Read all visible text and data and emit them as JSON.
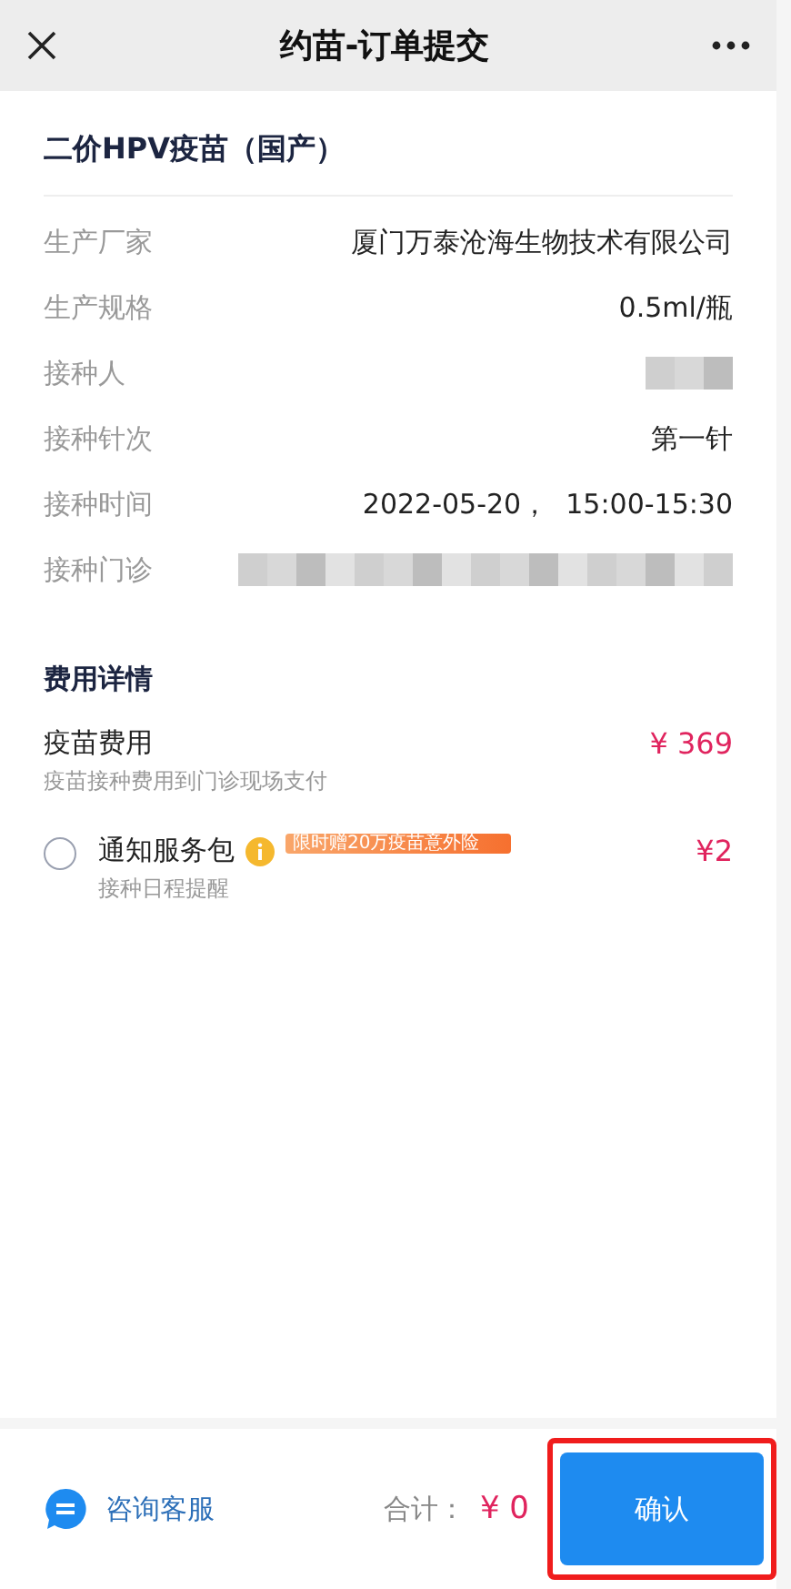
{
  "header": {
    "title": "约苗-订单提交"
  },
  "vaccine": {
    "name": "二价HPV疫苗（国产）"
  },
  "details": [
    {
      "label": "生产厂家",
      "kind": "text",
      "value": "厦门万泰沧海生物技术有限公司"
    },
    {
      "label": "生产规格",
      "kind": "text",
      "value": "0.5ml/瓶"
    },
    {
      "label": "接种人",
      "kind": "blurred"
    },
    {
      "label": "接种针次",
      "kind": "text",
      "value": "第一针"
    },
    {
      "label": "接种时间",
      "kind": "text",
      "value": "2022-05-20，  15:00-15:30"
    },
    {
      "label": "接种门诊",
      "kind": "blurred-wide"
    }
  ],
  "fees": {
    "title": "费用详情",
    "vaccine_fee": {
      "label": "疫苗费用",
      "note": "疫苗接种费用到门诊现场支付",
      "amount": "¥ 369"
    },
    "service": {
      "label": "通知服务包",
      "badge": "限时赠20万疫苗意外险",
      "note": "接种日程提醒",
      "amount": "¥2",
      "selected": false
    }
  },
  "footer": {
    "service_link": "咨询客服",
    "total_label": "合计：",
    "total": "¥ 0",
    "confirm": "确认"
  }
}
